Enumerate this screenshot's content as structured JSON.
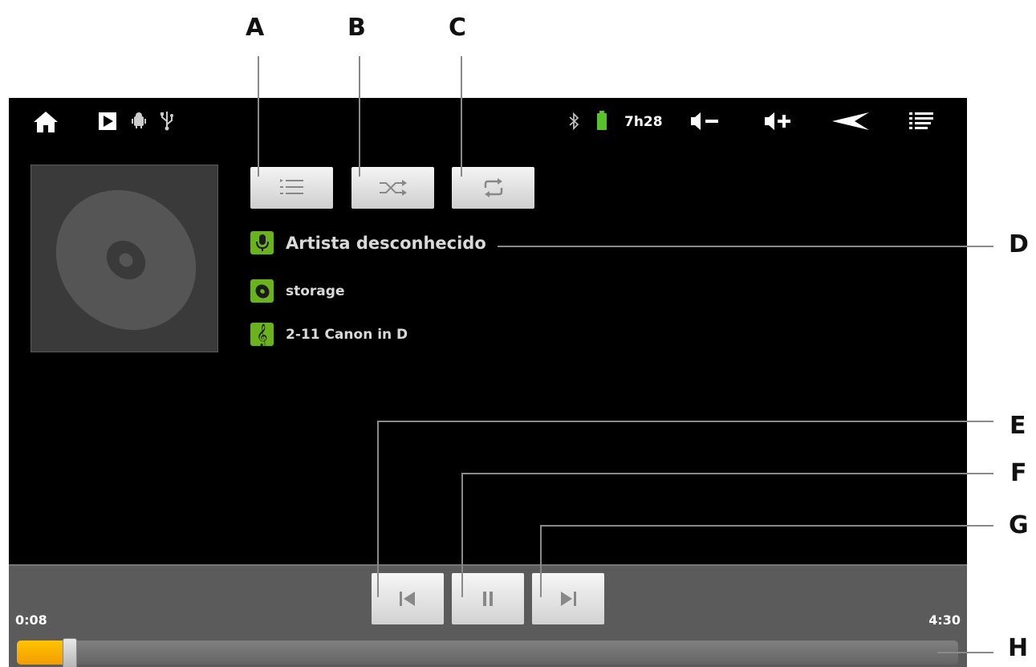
{
  "callouts": {
    "a": "A",
    "b": "B",
    "c": "C",
    "d": "D",
    "e": "E",
    "f": "F",
    "g": "G",
    "h": "H"
  },
  "status_bar": {
    "battery_time": "7h28",
    "icons": [
      "home-icon",
      "media-play-icon",
      "android-debug-icon",
      "usb-icon",
      "bluetooth-icon",
      "battery-icon",
      "volume-down-icon",
      "volume-up-icon",
      "back-icon",
      "menu-icon"
    ]
  },
  "toolbar": {
    "buttons": [
      "playlist-button",
      "shuffle-button",
      "repeat-button"
    ]
  },
  "track": {
    "artist": "Artista desconhecido",
    "album": "storage",
    "title": "2-11 Canon in D"
  },
  "playback": {
    "elapsed": "0:08",
    "duration": "4:30",
    "progress": 0.03
  },
  "colors": {
    "accent_green": "#6bb31d",
    "progress_orange": "#ffb300",
    "battery_green": "#58c22a"
  }
}
